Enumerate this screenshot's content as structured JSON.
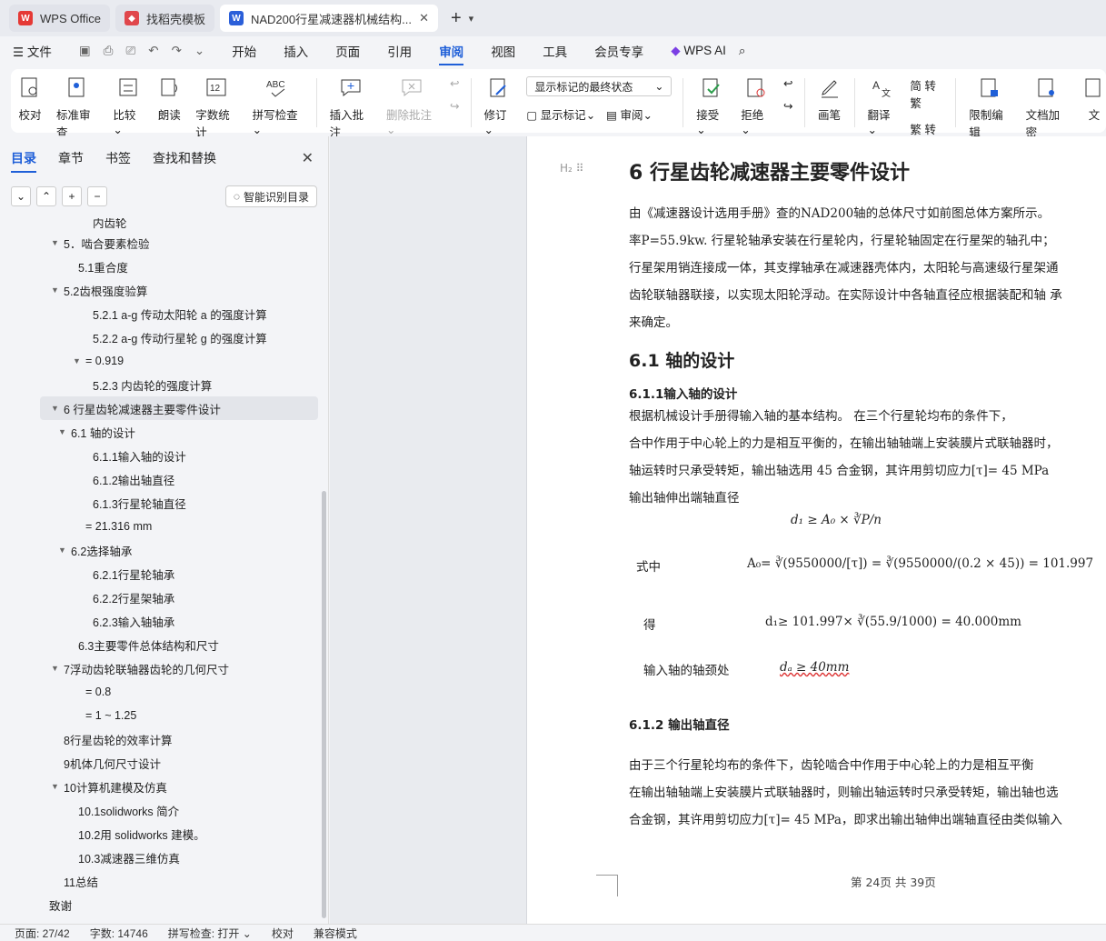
{
  "tabs": [
    {
      "label": "WPS Office"
    },
    {
      "label": "找稻壳模板"
    },
    {
      "label": "NAD200行星减速器机械结构..."
    }
  ],
  "menu": [
    "文件",
    "开始",
    "插入",
    "页面",
    "引用",
    "审阅",
    "视图",
    "工具",
    "会员专享",
    "WPS AI"
  ],
  "ribbon": {
    "proofread": "校对",
    "std_review": "标准审查",
    "compare": "比较",
    "read": "朗读",
    "word_count": "字数统计",
    "spell": "拼写检查",
    "insert_comment": "插入批注",
    "delete_comment": "删除批注",
    "revise": "修订",
    "show_mode": "显示标记的最终状态",
    "show_marks": "显示标记",
    "review": "审阅",
    "accept": "接受",
    "reject": "拒绝",
    "pen": "画笔",
    "translate": "翻译",
    "to_trad": "简 转繁",
    "to_simp": "繁 转简",
    "restrict": "限制编辑",
    "encrypt": "文档加密",
    "doc": "文"
  },
  "nav": {
    "tabs": [
      "目录",
      "章节",
      "书签",
      "查找和替换"
    ],
    "smart_btn": "智能识别目录",
    "items": [
      {
        "label": "内齿轮",
        "indent": 2,
        "tri": ""
      },
      {
        "label": "5．啮合要素检验",
        "indent": 0,
        "tri": "▼"
      },
      {
        "label": "5.1重合度",
        "indent": 1,
        "tri": ""
      },
      {
        "label": "5.2齿根强度验算",
        "indent": 0,
        "tri": "▼"
      },
      {
        "label": "5.2.1 a-g 传动太阳轮 a 的强度计算",
        "indent": 2,
        "tri": ""
      },
      {
        "label": "5.2.2 a-g 传动行星轮 g 的强度计算",
        "indent": 2,
        "tri": ""
      },
      {
        "label": "= 0.919",
        "indent": 1.5,
        "tri": "▼"
      },
      {
        "label": "5.2.3 内齿轮的强度计算",
        "indent": 2,
        "tri": ""
      },
      {
        "label": "6 行星齿轮减速器主要零件设计",
        "indent": 0,
        "tri": "▼",
        "selected": true
      },
      {
        "label": "6.1  轴的设计",
        "indent": 0.5,
        "tri": "▼"
      },
      {
        "label": "6.1.1输入轴的设计",
        "indent": 2,
        "tri": ""
      },
      {
        "label": "6.1.2输出轴直径",
        "indent": 2,
        "tri": ""
      },
      {
        "label": "6.1.3行星轮轴直径",
        "indent": 2,
        "tri": ""
      },
      {
        "label": "= 21.316 mm",
        "indent": 1.5,
        "tri": ""
      },
      {
        "label": "6.2选择轴承",
        "indent": 0.5,
        "tri": "▼"
      },
      {
        "label": "6.2.1行星轮轴承",
        "indent": 2,
        "tri": ""
      },
      {
        "label": "6.2.2行星架轴承",
        "indent": 2,
        "tri": ""
      },
      {
        "label": "6.2.3输入轴轴承",
        "indent": 2,
        "tri": ""
      },
      {
        "label": "6.3主要零件总体结构和尺寸",
        "indent": 1,
        "tri": ""
      },
      {
        "label": "7浮动齿轮联轴器齿轮的几何尺寸",
        "indent": 0,
        "tri": "▼"
      },
      {
        "label": "= 0.8",
        "indent": 1.5,
        "tri": ""
      },
      {
        "label": "= 1 ~ 1.25",
        "indent": 1.5,
        "tri": ""
      },
      {
        "label": "8行星齿轮的效率计算",
        "indent": 0,
        "tri": ""
      },
      {
        "label": "9机体几何尺寸设计",
        "indent": 0,
        "tri": ""
      },
      {
        "label": "10计算机建模及仿真",
        "indent": 0,
        "tri": "▼"
      },
      {
        "label": "10.1solidworks 简介",
        "indent": 1,
        "tri": ""
      },
      {
        "label": "10.2用 solidworks 建模。",
        "indent": 1,
        "tri": ""
      },
      {
        "label": "10.3减速器三维仿真",
        "indent": 1,
        "tri": ""
      },
      {
        "label": "11总结",
        "indent": 0,
        "tri": ""
      },
      {
        "label": "致谢",
        "indent": -1,
        "tri": ""
      }
    ]
  },
  "doc": {
    "h1": "6 行星齿轮减速器主要零件设计",
    "intro": [
      "   由《减速器设计选用手册》查的NAD200轴的总体尺寸如前图总体方案所示。",
      "率P=55.9kw.   行星轮轴承安装在行星轮内，行星轮轴固定在行星架的轴孔中；",
      "行星架用销连接成一体，其支撑轴承在减速器壳体内，太阳轮与高速级行星架通",
      "齿轮联轴器联接，以实现太阳轮浮动。在实际设计中各轴直径应根据装配和轴 承",
      "来确定。"
    ],
    "h2": "6.1  轴的设计",
    "h3": "6.1.1输入轴的设计",
    "p2": [
      "    根据机械设计手册得输入轴的基本结构。  在三个行星轮均布的条件下，",
      "合中作用于中心轮上的力是相互平衡的，在输出轴轴端上安装膜片式联轴器时，",
      "轴运转时只承受转矩，输出轴选用  45  合金钢，其许用剪切应力[τ]= 45 MPa",
      "输出轴伸出端轴直径"
    ],
    "f1": "d₁ ≥ A₀ × ∛P/n",
    "label_shizhong": "式中",
    "f2": "A₀= ∛(9550000/[τ]) = ∛(9550000/(0.2 × 45)) = 101.997",
    "label_de": "得",
    "f3": "d₁≥ 101.997× ∛(55.9/1000) = 40.000mm",
    "label_neck": "输入轴的轴颈处",
    "f4": "dₐ ≥ 40mm",
    "h3b": "6.1.2    输出轴直径",
    "p3": [
      "    由于三个行星轮均布的条件下，齿轮啮合中作用于中心轮上的力是相互平衡",
      "在输出轴轴端上安装膜片式联轴器时，则输出轴运转时只承受转矩，输出轴也选",
      "合金钢，其许用剪切应力[τ]= 45 MPa，即求出输出轴伸出端轴直径由类似输入"
    ],
    "footer": "第 24页  共 39页"
  },
  "status": {
    "page": "页面: 27/42",
    "words": "字数: 14746",
    "spell": "拼写检查: 打开",
    "proof": "校对",
    "compat": "兼容模式"
  },
  "colors": {
    "accent": "#1f5fd8",
    "wps_red": "#e53935",
    "docer_red": "#e0474c",
    "word_blue": "#2b5fd9"
  }
}
